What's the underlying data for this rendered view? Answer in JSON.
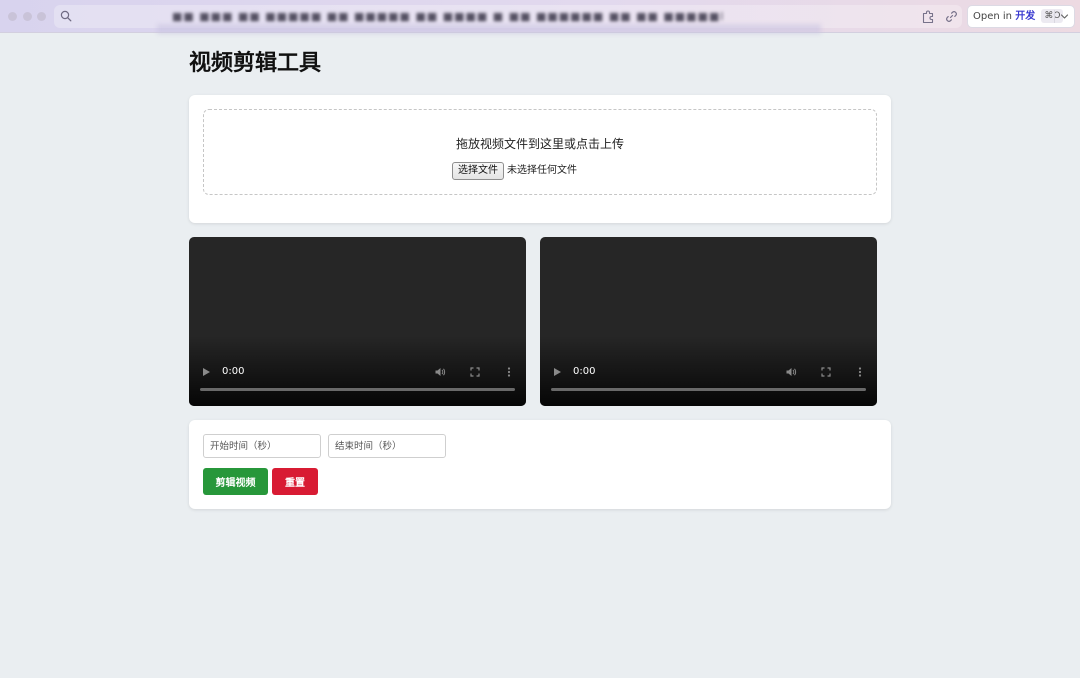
{
  "browser": {
    "url_text": "■■ ■■■ ■■ ■■■■■ ■■ ■■■■■ ■■ ■■■■ ■ ■■ ■■■■■■ ■■ ■■ ■■■■■l",
    "open_in": {
      "prefix": "Open in",
      "app": "开发",
      "shortcut": "⌘O"
    },
    "icons": {
      "search": "search-icon",
      "extension": "puzzle-icon",
      "link": "link-icon",
      "chevron": "chevron-down-icon"
    }
  },
  "page": {
    "title": "视频剪辑工具"
  },
  "upload": {
    "prompt": "拖放视频文件到这里或点击上传",
    "file_button": "选择文件",
    "file_status": "未选择任何文件"
  },
  "videos": [
    {
      "time": "0:00"
    },
    {
      "time": "0:00"
    }
  ],
  "controls": {
    "start_placeholder": "开始时间（秒）",
    "end_placeholder": "结束时间（秒）",
    "clip_label": "剪辑视频",
    "reset_label": "重置"
  },
  "colors": {
    "clip_button": "#27973a",
    "reset_button": "#d81b33",
    "page_background": "#eaeef1"
  }
}
